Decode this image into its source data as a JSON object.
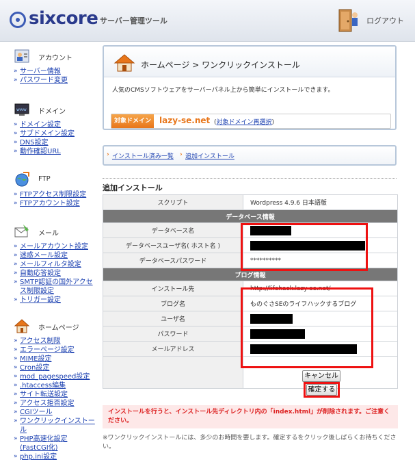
{
  "header": {
    "logo_text": "sixcore",
    "logo_sub": "サーバー管理ツール",
    "logout_label": "ログアウト"
  },
  "sidebar": {
    "account": {
      "title": "アカウント",
      "items": [
        "サーバー情報",
        "パスワード変更"
      ]
    },
    "domain": {
      "title": "ドメイン",
      "items": [
        "ドメイン設定",
        "サブドメイン設定",
        "DNS設定",
        "動作確認URL"
      ]
    },
    "ftp": {
      "title": "FTP",
      "items": [
        "FTPアクセス制限設定",
        "FTPアカウント設定"
      ]
    },
    "mail": {
      "title": "メール",
      "items": [
        "メールアカウント設定",
        "迷惑メール設定",
        "メールフィルタ設定",
        "自動応答設定",
        "SMTP認証の国外アクセス制限設定",
        "トリガー設定"
      ]
    },
    "homepage": {
      "title": "ホームページ",
      "items": [
        "アクセス制限",
        "エラーページ設定",
        "MIME設定",
        "Cron設定",
        "mod_pagespeed設定",
        ".htaccess編集",
        "サイト転送設定",
        "アクセス拒否設定",
        "CGIツール",
        "ワンクリックインストール",
        "PHP高速化設定(FastCGI化)",
        "php.ini設定"
      ]
    }
  },
  "main": {
    "title": "ホームページ > ワンクリックインストール",
    "description": "人気のCMSソフトウェアをサーバーパネル上から簡単にインストールできます。",
    "domain_badge": "対象ドメイン",
    "domain_name": "lazy-se.net",
    "domain_link_open": "(",
    "domain_link": "対象ドメイン再選択",
    "domain_link_close": ")",
    "breadcrumb": [
      "インストール済み一覧",
      "追加インストール"
    ],
    "section_title": "追加インストール",
    "script_label": "スクリプト",
    "script_value": "Wordpress 4.9.6 日本語版",
    "db_group": "データベース情報",
    "db_name_label": "データベース名",
    "db_user_label": "データベースユーザ名( ホスト名 )",
    "db_pass_label": "データベースパスワード",
    "db_pass_value": "**********",
    "blog_group": "ブログ情報",
    "install_to_label": "インストール先",
    "install_to_value": "http://lifehack.lazy-se.net/",
    "blog_name_label": "ブログ名",
    "blog_name_value": "ものぐさSEのライフハックするブログ",
    "user_label": "ユーザ名",
    "password_label": "パスワード",
    "email_label": "メールアドレス",
    "cancel_button": "キャンセル",
    "confirm_button": "確定する",
    "warning": "インストールを行うと、インストール先ディレクトリ内の「index.html」が削除されます。ご注意ください。",
    "note": "※ワンクリックインストールには、多少のお時間を要します。確定するをクリック後しばらくお待ちください。"
  },
  "colors": {
    "accent_orange": "#e8761a",
    "link_blue": "#1a3fb0",
    "highlight_red": "#ee1111",
    "group_header_gray": "#777777"
  }
}
